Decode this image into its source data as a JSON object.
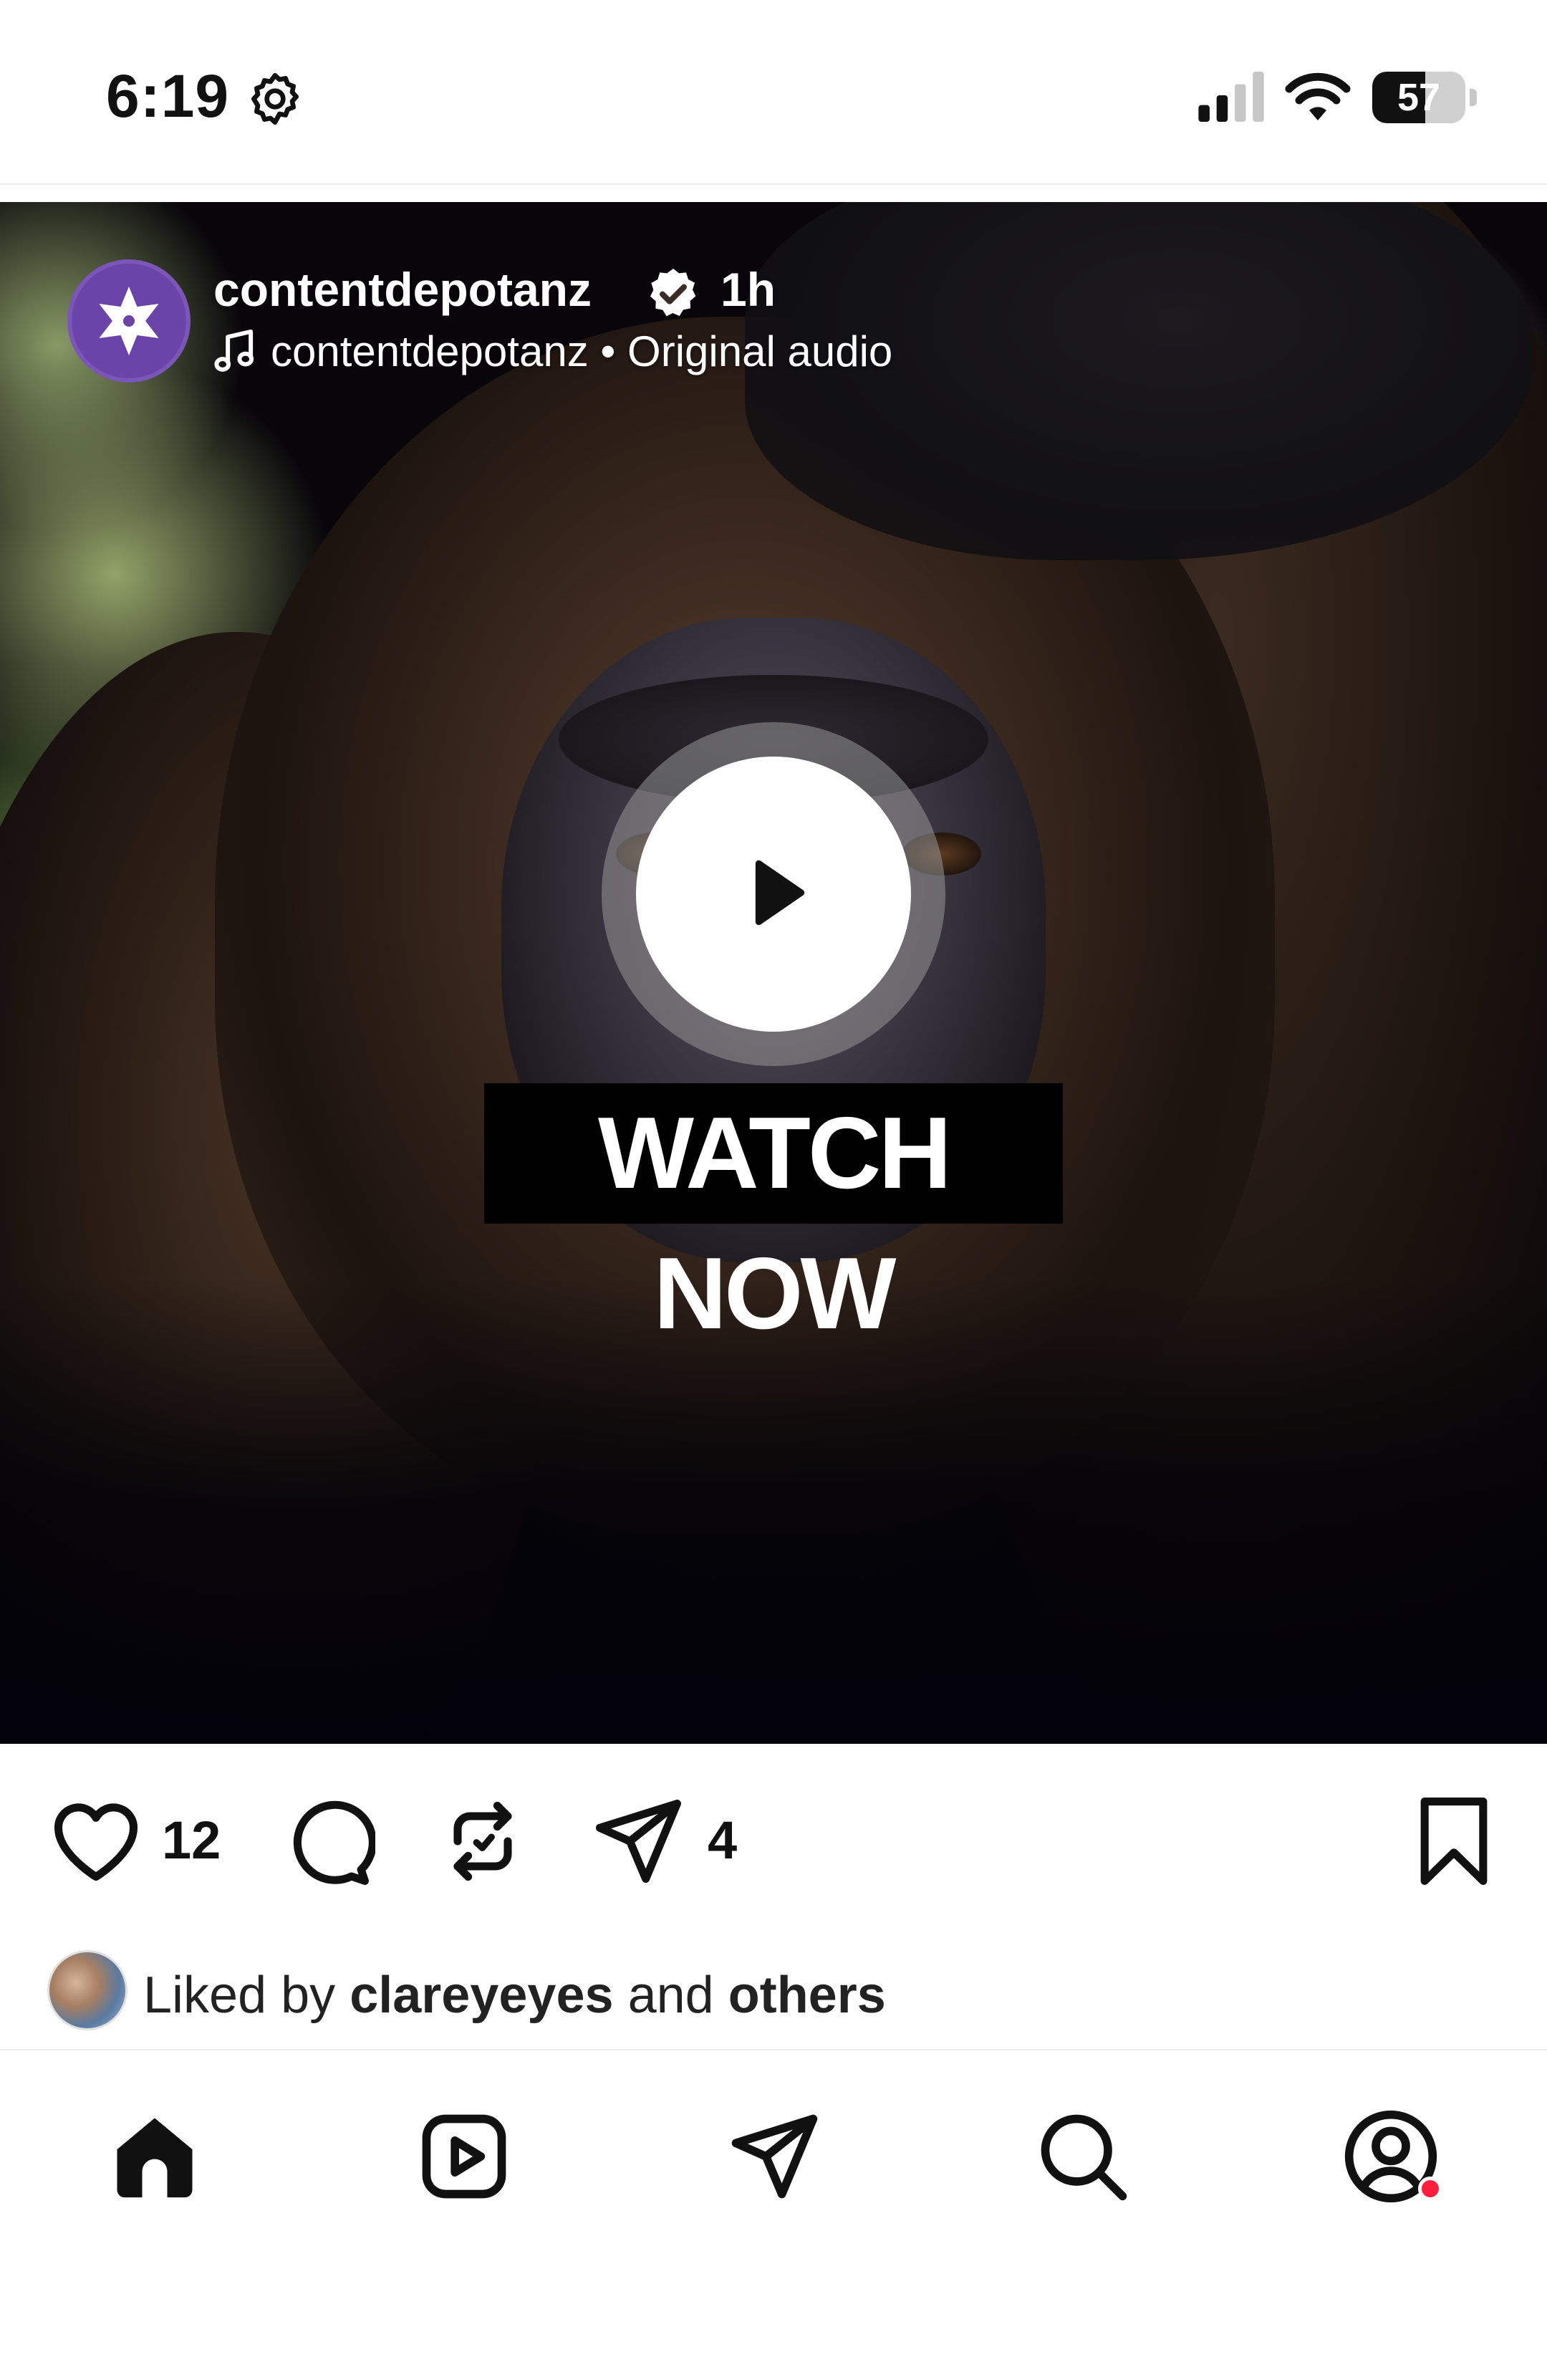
{
  "status_bar": {
    "time": "6:19",
    "battery_level": "57",
    "battery_fraction": 0.57,
    "icons": [
      "gear-icon",
      "cellular-signal-icon",
      "wifi-icon",
      "battery-icon"
    ]
  },
  "post": {
    "username": "contentdepotanz",
    "verified": true,
    "time_ago": "1h",
    "audio": "contentdepotanz • Original audio",
    "overlay_text": "WATCH NOW",
    "likes": "12",
    "shares": "4",
    "liked_by_prefix": "Liked by",
    "liked_by_user": "clareyeyes",
    "liked_by_and": "and",
    "liked_by_others": "others"
  },
  "colors": {
    "brand_avatar": "#6a44a8",
    "notification_dot": "#ff1f3d"
  },
  "nav": {
    "items": [
      "home-icon",
      "reels-icon",
      "messages-icon",
      "search-icon",
      "profile-icon"
    ]
  }
}
